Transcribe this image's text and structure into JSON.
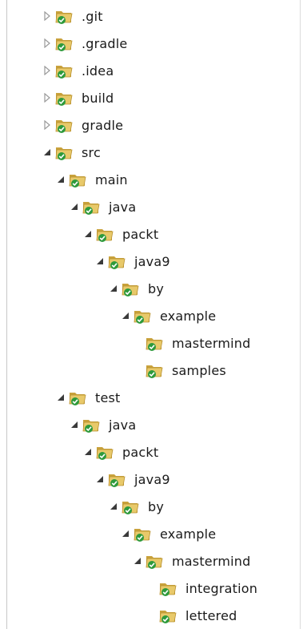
{
  "tree": {
    "items": [
      {
        "label": ".git",
        "state": "collapsed"
      },
      {
        "label": ".gradle",
        "state": "collapsed"
      },
      {
        "label": ".idea",
        "state": "collapsed"
      },
      {
        "label": "build",
        "state": "collapsed"
      },
      {
        "label": "gradle",
        "state": "collapsed"
      },
      {
        "label": "src",
        "state": "expanded"
      },
      {
        "label": "main",
        "state": "expanded"
      },
      {
        "label": "java",
        "state": "expanded"
      },
      {
        "label": "packt",
        "state": "expanded"
      },
      {
        "label": "java9",
        "state": "expanded"
      },
      {
        "label": "by",
        "state": "expanded"
      },
      {
        "label": "example",
        "state": "expanded"
      },
      {
        "label": "mastermind",
        "state": "leaf"
      },
      {
        "label": "samples",
        "state": "leaf"
      },
      {
        "label": "test",
        "state": "expanded"
      },
      {
        "label": "java",
        "state": "expanded"
      },
      {
        "label": "packt",
        "state": "expanded"
      },
      {
        "label": "java9",
        "state": "expanded"
      },
      {
        "label": "by",
        "state": "expanded"
      },
      {
        "label": "example",
        "state": "expanded"
      },
      {
        "label": "mastermind",
        "state": "expanded"
      },
      {
        "label": "integration",
        "state": "leaf"
      },
      {
        "label": "lettered",
        "state": "leaf"
      }
    ]
  },
  "colors": {
    "folder_fill": "#e8c96a",
    "folder_dark": "#c9a23c",
    "overlay_green": "#2e9a3c",
    "toggle_collapsed": "#9a9a9a",
    "toggle_expanded": "#3a3a3a"
  },
  "icons": {
    "folder": "folder-icon",
    "overlay": "checkmark-overlay-icon",
    "expand": "expand-triangle-icon",
    "collapse": "collapse-triangle-icon"
  }
}
